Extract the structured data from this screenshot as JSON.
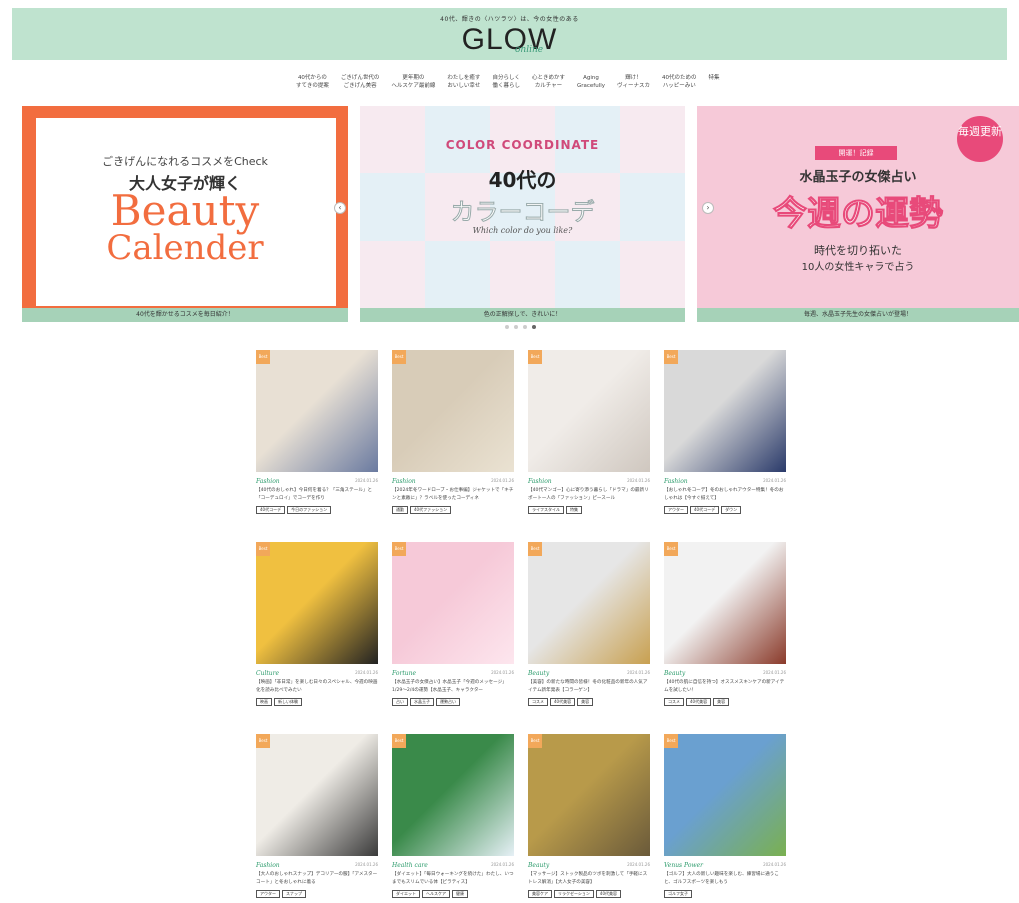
{
  "header": {
    "tagline": "40代、輝きの〈ハツラツ〉は、今の女性のある",
    "logo": "GLOW",
    "logo_sub": "online"
  },
  "nav": [
    [
      "40代からの",
      "すてきの提案"
    ],
    [
      "ごきげん世代の",
      "ごきげん美容"
    ],
    [
      "更年期の",
      "ヘルスケア最前線"
    ],
    [
      "わたしを癒す",
      "おいしい幸せ"
    ],
    [
      "自分らしく",
      "働く暮らし"
    ],
    [
      "心ときめかす",
      "カルチャー"
    ],
    [
      "Aging",
      "Gracefully"
    ],
    [
      "輝け！",
      "ヴィーナスカ"
    ],
    [
      "40代のための",
      "ハッピーみい"
    ],
    [
      "特集",
      ""
    ]
  ],
  "carousel": {
    "slides": [
      {
        "sub": "ごきげんになれるコスメをCheck",
        "main": "大人女子が輝く",
        "beauty": "Beauty",
        "calender": "Calender",
        "caption": "40代を輝かせるコスメを毎日紹介！"
      },
      {
        "color": "COLOR COORDINATE",
        "title": "40代の",
        "kana": "カラーコーデ",
        "which": "Which color do you like?",
        "caption": "色の正解探しで、きれいに！"
      },
      {
        "badge": "毎週更新",
        "ribbon": "開運！記録",
        "name": "水晶玉子の女傑占い",
        "main": "今週の運勢",
        "sub1": "時代を切り拓いた",
        "sub2": "10人の女性キャラで占う",
        "caption": "毎週、水晶玉子先生の女傑占いが登場！"
      }
    ],
    "prev": "‹",
    "next": "›"
  },
  "articles": [
    {
      "badge": "Best",
      "category": "Fashion",
      "date": "2024.01.26",
      "title": "【40代のおしゃれ】今日何を着る？「三角ステール」と「コーデュロイ」でコーデを作り",
      "tags": [
        "40代コーデ",
        "今日のファッション"
      ],
      "colors": [
        "#e8e0d4",
        "#6a7aa0"
      ]
    },
    {
      "badge": "Best",
      "category": "Fashion",
      "date": "2024.01.26",
      "title": "【2024年冬ワードローブ・お仕事編】ジャケットで「キチンと素敵に」？ラベルを使ったコーディネ",
      "tags": [
        "通勤",
        "40代ファッション"
      ],
      "colors": [
        "#d8ccb8",
        "#eae2d2"
      ]
    },
    {
      "badge": "Best",
      "category": "Fashion",
      "date": "2024.01.26",
      "title": "【40代マンゴー】心に寄り添う暮らし「ドラマ」の最新リポートー人の「ファッション」ピースール",
      "tags": [
        "ライフスタイル",
        "特集"
      ],
      "colors": [
        "#f0ece8",
        "#cfc7bf"
      ]
    },
    {
      "badge": "Best",
      "category": "Fashion",
      "date": "2024.01.26",
      "title": "【おしゃれ冬コーデ】冬のおしゃれアウター特集！冬のおしゃれは【今すぐ揃えて】",
      "tags": [
        "アウター",
        "40代コーデ",
        "ダウン"
      ],
      "colors": [
        "#d9d9d9",
        "#2a3a6a"
      ]
    },
    {
      "badge": "Best",
      "category": "Culture",
      "date": "2024.01.26",
      "title": "【映画】「非日常」を楽しむ日々のスペシャル、今週の映画化を読み比べでみたい",
      "tags": [
        "映画",
        "新しい体験"
      ],
      "colors": [
        "#f0c040",
        "#222222"
      ]
    },
    {
      "badge": "Best",
      "category": "Fortune",
      "date": "2024.01.26",
      "title": "【水晶玉子の女傑占い】水晶玉子「今週のメッセージ」1/29〜2/4の運勢【水晶玉子、キャラクター",
      "tags": [
        "占い",
        "水晶玉子",
        "運勢占い"
      ],
      "colors": [
        "#f6c9d8",
        "#fde6ee"
      ]
    },
    {
      "badge": "Best",
      "category": "Beauty",
      "date": "2024.01.26",
      "title": "【美容】の新たな時間の皆様！冬の化粧品の新年の人気アイテム新年発表【コラーゲン】",
      "tags": [
        "コスメ",
        "40代美容",
        "美容"
      ],
      "colors": [
        "#e6e6e6",
        "#c8a050"
      ]
    },
    {
      "badge": "Best",
      "category": "Beauty",
      "date": "2024.01.26",
      "title": "【40代の肌に自信を持つ】オススメスキンケアの新アイテムを試したい！",
      "tags": [
        "コスメ",
        "40代美容",
        "美容"
      ],
      "colors": [
        "#f2f2f2",
        "#8a3a2a"
      ]
    },
    {
      "badge": "Best",
      "category": "Fashion",
      "date": "2024.01.26",
      "title": "【大人のおしゃれスナップ】デコリアーの服】「アメスターコート」と冬おしゃれに着る",
      "tags": [
        "アウター",
        "スナップ"
      ],
      "colors": [
        "#efece6",
        "#3a3a3a"
      ]
    },
    {
      "badge": "Best",
      "category": "Health care",
      "date": "2024.01.26",
      "title": "【ダイエット】「毎日ウォーキングを続けた」わたし、いつまでもスリムでいる体【ピラティス】",
      "tags": [
        "ダイエット",
        "ヘルスケア",
        "健康"
      ],
      "colors": [
        "#3a8a4a",
        "#e6f0f6"
      ]
    },
    {
      "badge": "Best",
      "category": "Beauty",
      "date": "2024.01.26",
      "title": "【マッサージ】ストック製品のツボを刺激して「手軽にストレス解消」【大人女子の美容】",
      "tags": [
        "美容ケア",
        "リラクゼーション",
        "40代美容"
      ],
      "colors": [
        "#b89a4a",
        "#6a5a3a"
      ]
    },
    {
      "badge": "Best",
      "category": "Venus Power",
      "date": "2024.01.26",
      "title": "【ゴルフ】大人の新しい趣味を楽しむ、練習場に通うこと、ゴルフスポーツを楽しもう",
      "tags": [
        "ゴルフ女子"
      ],
      "colors": [
        "#6aa0d0",
        "#7ab050"
      ]
    }
  ]
}
